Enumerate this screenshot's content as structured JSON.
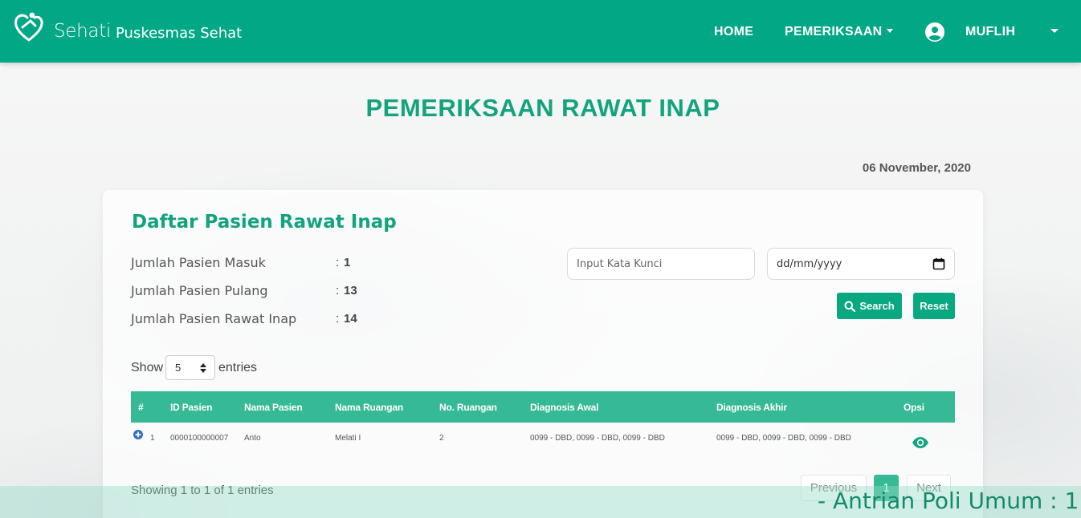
{
  "colors": {
    "primary": "#02a885",
    "title": "#14a37f",
    "table_header": "#36b995"
  },
  "navbar": {
    "brand_name": "Sehati",
    "brand_sub": "Puskesmas Sehat",
    "home_label": "HOME",
    "pemeriksaan_label": "PEMERIKSAAN",
    "user_label": "MUFLIH",
    "icons": {
      "logo": "heart-person-logo",
      "user": "user-circle-icon"
    }
  },
  "page": {
    "title": "PEMERIKSAAN RAWAT INAP",
    "date": "06 November, 2020"
  },
  "card": {
    "title": "Daftar Pasien Rawat Inap",
    "stats": [
      {
        "label": "Jumlah Pasien Masuk",
        "colon": ":",
        "value": "1"
      },
      {
        "label": "Jumlah Pasien Pulang",
        "colon": ":",
        "value": "13"
      },
      {
        "label": "Jumlah Pasien Rawat Inap",
        "colon": ":",
        "value": "14"
      }
    ]
  },
  "filter": {
    "keyword_placeholder": "Input Kata Kunci",
    "date_placeholder": "dd/mm/yyyy",
    "search_label": "Search",
    "reset_label": "Reset"
  },
  "table": {
    "show_label": "Show",
    "entries_label": "entries",
    "page_size": "5",
    "columns": [
      "#",
      "ID Pasien",
      "Nama Pasien",
      "Nama Ruangan",
      "No. Ruangan",
      "Diagnosis Awal",
      "Diagnosis Akhir",
      "Opsi"
    ],
    "rows": [
      {
        "no": "1",
        "id_pasien": "0000100000007",
        "nama_pasien": "Anto",
        "nama_ruangan": "Melati I",
        "no_ruangan": "2",
        "diagnosis_awal": "0099 - DBD, 0099 - DBD, 0099 - DBD",
        "diagnosis_akhir": "0099 - DBD, 0099 - DBD, 0099 - DBD"
      }
    ],
    "info": "Showing 1 to 1 of 1 entries",
    "pagination": {
      "previous": "Previous",
      "current": "1",
      "next": "Next"
    }
  },
  "marquee": "- Antrian Poli Umum : 1"
}
